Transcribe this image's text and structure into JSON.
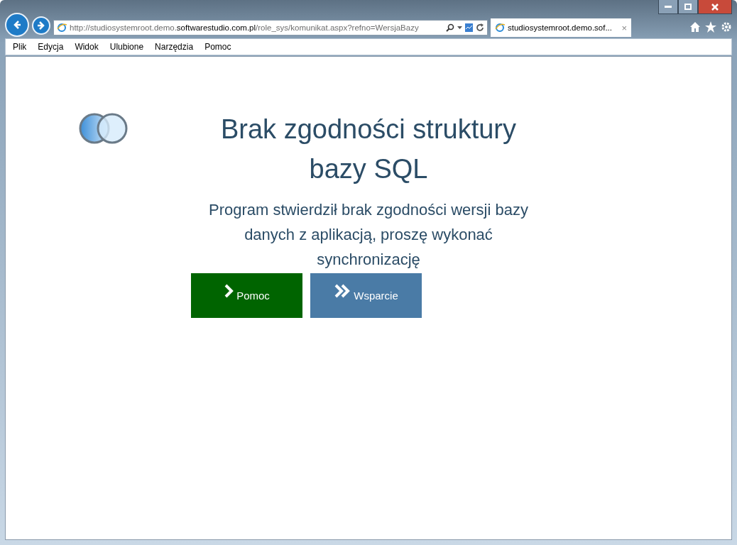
{
  "browser": {
    "address": "http://studiosystemroot.demo.**softwarestudio.com.pl**/role_sys/komunikat.aspx?refno=WersjaBazy",
    "tab_title": "studiosystemroot.demo.sof...",
    "tab_close": "×"
  },
  "menu": [
    "Plik",
    "Edycja",
    "Widok",
    "Ulubione",
    "Narzędzia",
    "Pomoc"
  ],
  "page": {
    "title": "Brak zgodności struktury bazy SQL",
    "message": "Program stwierdził brak zgodności wersji bazy danych z aplikacją, proszę wykonać synchronizację",
    "buttons": [
      {
        "label": "Pomoc",
        "kind": "single",
        "color": "#006400"
      },
      {
        "label": "Wsparcie",
        "kind": "double",
        "color": "#4a7ba6"
      }
    ]
  }
}
